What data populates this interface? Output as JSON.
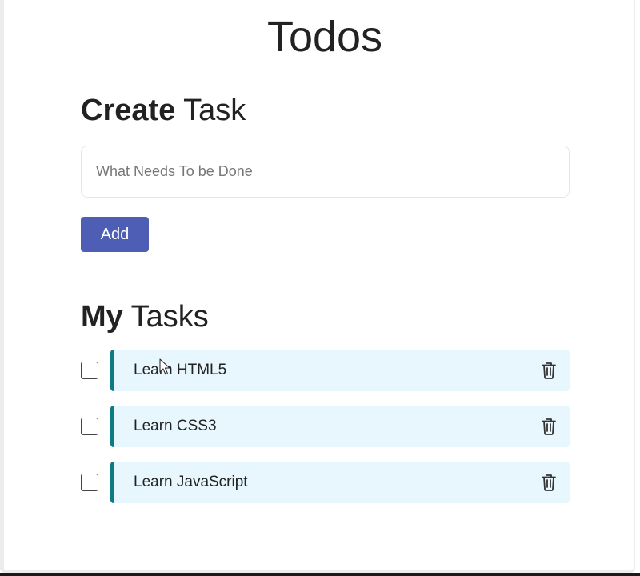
{
  "app": {
    "title": "Todos"
  },
  "create_section": {
    "heading_bold": "Create",
    "heading_rest": " Task",
    "input_placeholder": "What Needs To be Done",
    "input_value": "",
    "add_label": "Add"
  },
  "tasks_section": {
    "heading_bold": "My",
    "heading_rest": " Tasks",
    "tasks": [
      {
        "label": "Learn HTML5",
        "checked": false,
        "icon": "trash-icon"
      },
      {
        "label": "Learn CSS3",
        "checked": false,
        "icon": "trash-icon"
      },
      {
        "label": "Learn JavaScript",
        "checked": false,
        "icon": "trash-icon"
      }
    ]
  },
  "colors": {
    "accent_button": "#4f5eb5",
    "task_background": "#e8f6fd",
    "task_border": "#0d7b86"
  }
}
